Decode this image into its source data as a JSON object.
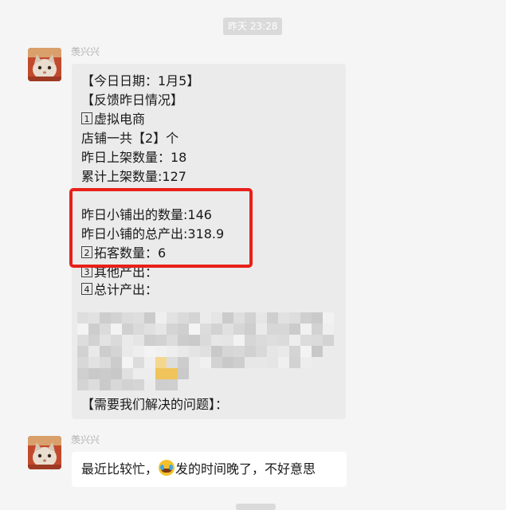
{
  "timestamp": "昨天 23:28",
  "messages": [
    {
      "sender": "羡兴兴",
      "lines": [
        "【今日日期：1月5】",
        "【反馈昨日情况】",
        "虚拟电商",
        "店铺一共【2】个",
        "昨日上架数量：18",
        "累计上架数量:127",
        "",
        "昨日小铺出的数量:146",
        "昨日小铺的总产出:318.9",
        "拓客数量：6",
        "其他产出：",
        "总计产出：",
        "【需要我们解决的问题】："
      ],
      "item_numbers": [
        "1",
        "2",
        "3",
        "4"
      ]
    },
    {
      "sender": "羡兴兴",
      "text_before_emoji": "最近比较忙，",
      "emoji": "face-with-tears-of-joy-emoji",
      "text_after_emoji": "发的时间晚了，不好意思"
    }
  ],
  "colors": {
    "background": "#f5f5f5",
    "bubble_gray": "#ebebeb",
    "bubble_white": "#ffffff",
    "highlight": "#e8201a"
  }
}
